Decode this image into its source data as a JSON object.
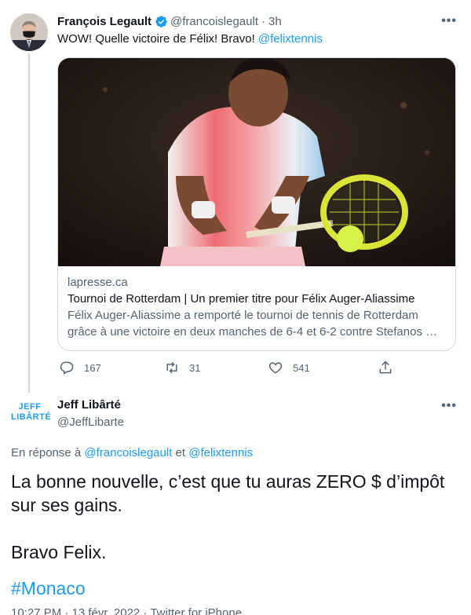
{
  "tweet1": {
    "author_name": "François Legault",
    "verified_icon": "verified-badge-icon",
    "handle": "@francoislegault",
    "separator": "·",
    "time": "3h",
    "more_label": "•••",
    "text_prefix": "WOW! Quelle victoire de Félix! Bravo! ",
    "mention": "@felixtennis",
    "card": {
      "image_alt": "tennis player hitting backhand",
      "domain": "lapresse.ca",
      "title": "Tournoi de Rotterdam | Un premier titre pour Félix Auger-Aliassime",
      "description": "Félix Auger-Aliassime a remporté le tournoi de tennis de Rotterdam grâce à une victoire en deux manches de 6-4 et 6-2 contre Stefanos …"
    },
    "actions": {
      "replies": "167",
      "retweets": "31",
      "likes": "541"
    }
  },
  "tweet2": {
    "logo_line1": "JEFF",
    "logo_line2": "LIBÂRTÉ",
    "author_name": "Jeff Libârté",
    "handle": "@JeffLibarte",
    "more_label": "•••",
    "reply_prefix": "En réponse à ",
    "reply_mention1": "@francoislegault",
    "reply_and": " et ",
    "reply_mention2": "@felixtennis",
    "body_line1": "La bonne nouvelle, c’est que tu auras ZERO $ d’impôt sur ses gains.",
    "body_line2": "Bravo Felix.",
    "hashtag": "#Monaco",
    "footer_partial": "10:27 PM · 13 févr. 2022 · Twitter for iPhone"
  },
  "colors": {
    "accent": "#1d9bf0",
    "text": "#0f1419",
    "muted": "#536471",
    "border": "#cfd9de"
  }
}
